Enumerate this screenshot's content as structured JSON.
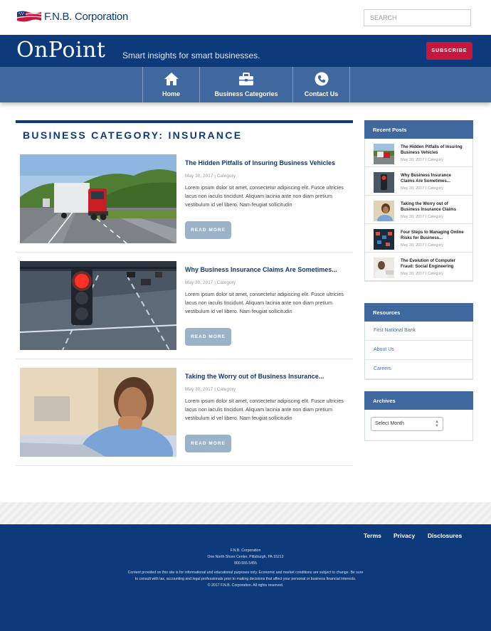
{
  "header": {
    "logo_text": "F.N.B. Corporation",
    "search_placeholder": "SEARCH"
  },
  "hero": {
    "brand": "OnPoint",
    "tagline": "Smart insights for smart businesses.",
    "subscribe_label": "SUBSCRIBE"
  },
  "nav": {
    "items": [
      {
        "label": "Home",
        "icon": "home-icon"
      },
      {
        "label": "Business Categories",
        "icon": "briefcase-icon"
      },
      {
        "label": "Contact Us",
        "icon": "phone-icon"
      }
    ]
  },
  "main": {
    "category_heading": "BUSINESS CATEGORY: INSURANCE",
    "posts": [
      {
        "title": "The Hidden Pitfalls of Insuring Business Vehicles",
        "meta": "May 30, 2017  |  Category",
        "excerpt": "Lorem ipsum dolor sit amet, consectetur adipiscing elit. Fusce ultricies lacus non iaculis tincidunt. Aliquam lacinia ante non diam pretium vestibulum id vel libero. Nam feugiat sollicitudin",
        "read_more": "READ MORE"
      },
      {
        "title": "Why Business Insurance Claims Are Sometimes...",
        "meta": "May 30, 2017  |  Category",
        "excerpt": "Lorem ipsum dolor sit amet, consectetur adipiscing elit. Fusce ultricies lacus non iaculis tincidunt. Aliquam lacinia ante non diam pretium vestibulum id vel libero. Nam feugiat sollicitudin",
        "read_more": "READ MORE"
      },
      {
        "title": "Taking the Worry out of Business Insurance...",
        "meta": "May 30, 2017  |  Category",
        "excerpt": "Lorem ipsum dolor sit amet, consectetur adipiscing elit. Fusce ultricies lacus non iaculis tincidunt. Aliquam lacinia ante non diam pretium vestibulum id vel libero. Nam feugiat sollicitudin",
        "read_more": "READ MORE"
      }
    ]
  },
  "sidebar": {
    "recent_posts": {
      "heading": "Recent Posts",
      "items": [
        {
          "title": "The Hidden Pitfalls of Insuring Business Vehicles",
          "meta": "May 30, 2017 | Category"
        },
        {
          "title": "Why Business Insurance Claims Are Sometimes...",
          "meta": "May 30, 2017 | Category"
        },
        {
          "title": "Taking the Worry out of Business Insurance Claims",
          "meta": "May 30, 2017 | Category"
        },
        {
          "title": "Four Steps to Managing Online Risks for Business...",
          "meta": "May 30, 2017 | Category"
        },
        {
          "title": "The Evolution of Computer Fraud: Social Engineering",
          "meta": "May 30, 2017 | Category"
        }
      ]
    },
    "resources": {
      "heading": "Resources",
      "links": [
        "First National Bank",
        "About Us",
        "Careers"
      ]
    },
    "archives": {
      "heading": "Archives",
      "selected": "Select Month"
    }
  },
  "footer": {
    "links": [
      "Terms",
      "Privacy",
      "Disclosures"
    ],
    "company": "F.N.B. Corporation",
    "address": "One North Shore Center, Pittsburgh, PA 15212",
    "phone": "800.555.5455",
    "disclaimer_1": "Content provided on this site is for informational and educational purposes only. Economic and market conditions are subject to change. Be sure",
    "disclaimer_2": "to consult with tax, accounting and legal professionals prior to making decisions that affect your personal or business financial interests.",
    "copyright": "© 2017 F.N.B. Corporation. All rights reserved."
  },
  "colors": {
    "navy": "#0d3a7a",
    "nav_blue": "#3f689f",
    "subscribe_red": "#c8173f",
    "read_more": "#9bb3c9",
    "link_blue": "#3f77b8"
  }
}
